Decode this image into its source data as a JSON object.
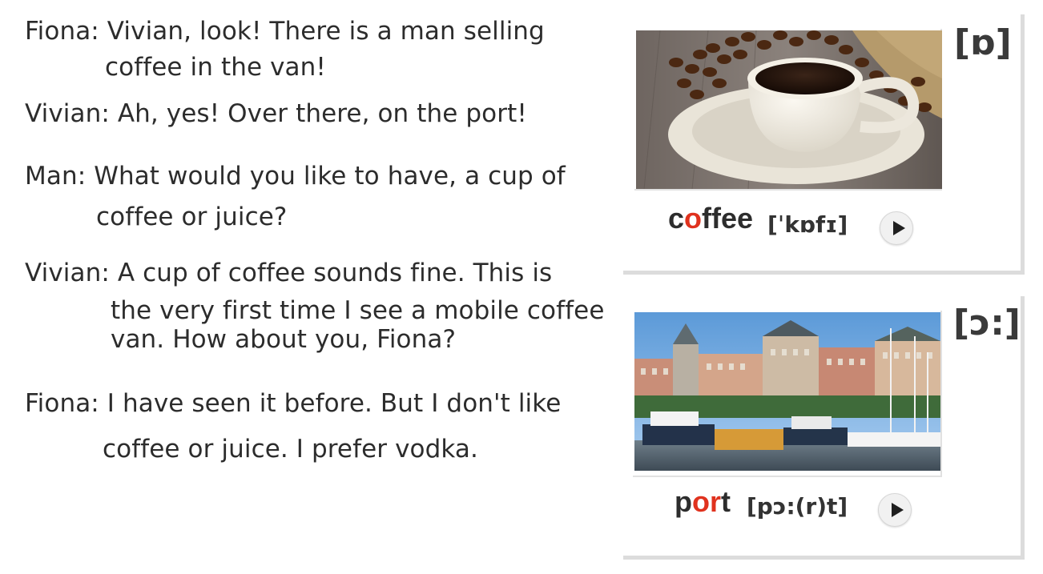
{
  "dialogue": [
    {
      "text": "Fiona: Vivian, look! There is a man selling"
    },
    {
      "text": "coffee in the van!"
    },
    {
      "text": "Vivian: Ah, yes! Over there, on the port!"
    },
    {
      "text": "Man: What would you like to have, a cup of"
    },
    {
      "text": "coffee or juice?"
    },
    {
      "text": "Vivian: A cup of coffee sounds fine. This is"
    },
    {
      "text": "the very first time I see a mobile coffee"
    },
    {
      "text": "van. How about you, Fiona?"
    },
    {
      "text": "Fiona: I have seen it before. But I don't like"
    },
    {
      "text": "coffee or juice. I prefer vodka."
    }
  ],
  "cards": [
    {
      "phoneme": "[ɒ]",
      "word_pre": "c",
      "word_hl": "o",
      "word_post": "ffee",
      "ipa": "[ˈkɒfɪ]",
      "image": "coffee-cup-photo"
    },
    {
      "phoneme": "[ɔ:]",
      "word_pre": "p",
      "word_hl": "or",
      "word_post": "t",
      "ipa": "[pɔ:(r)t]",
      "image": "harbor-port-photo"
    }
  ],
  "icons": {
    "play": "play-icon"
  },
  "colors": {
    "highlight": "#e0321e",
    "text": "#2c2c2c"
  }
}
